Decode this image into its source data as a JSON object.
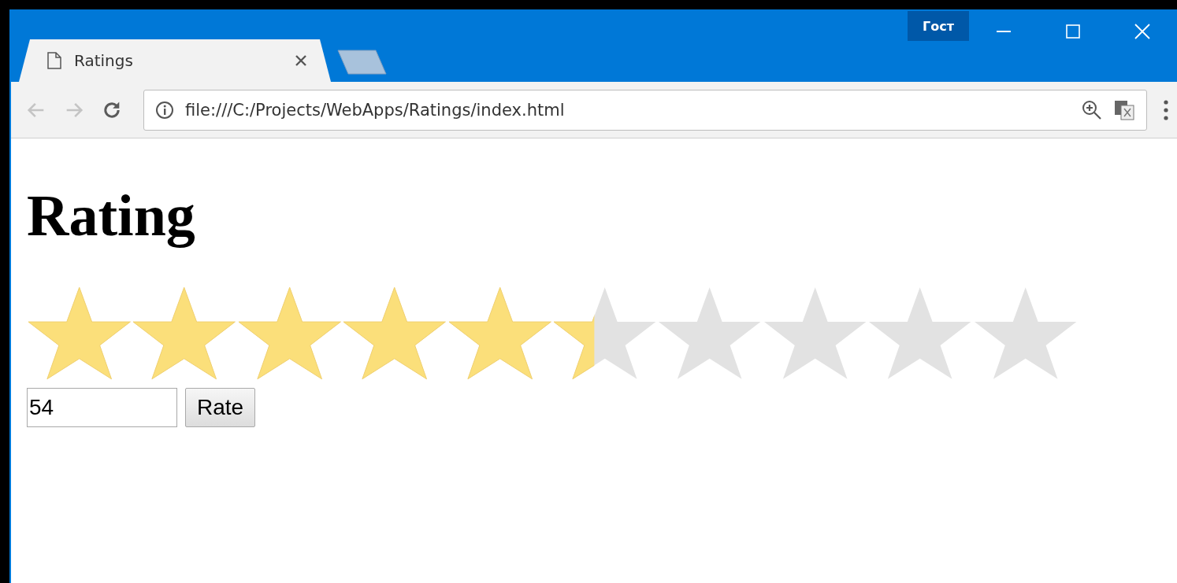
{
  "window": {
    "badge": "Гост"
  },
  "tabs": [
    {
      "title": "Ratings",
      "selected": true
    }
  ],
  "toolbar": {
    "nav_buttons": [
      {
        "kind": "back",
        "disabled": true
      },
      {
        "kind": "forward",
        "disabled": true
      },
      {
        "kind": "reload",
        "disabled": false
      }
    ],
    "url": "file:///C:/Projects/WebApps/Ratings/index.html"
  },
  "page": {
    "heading": "Rating",
    "rating": {
      "stars": 5.4
    },
    "input": {
      "value": "54"
    },
    "button": "Rate"
  }
}
